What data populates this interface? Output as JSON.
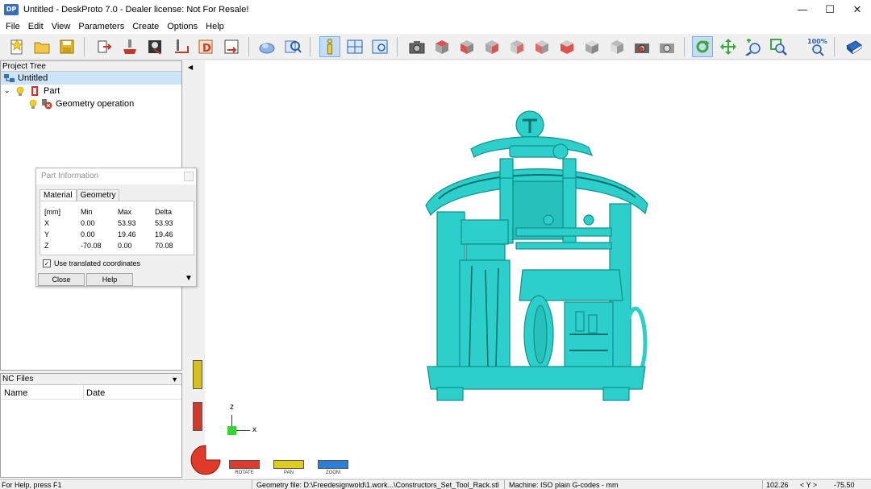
{
  "window": {
    "title": "Untitled - DeskProto 7.0 - Dealer license: Not For Resale!",
    "app_icon_text": "DP",
    "minimize": "—",
    "maximize": "☐",
    "close": "✕"
  },
  "menu": [
    "File",
    "Edit",
    "View",
    "Parameters",
    "Create",
    "Options",
    "Help"
  ],
  "toolbar": {
    "zoom_label": "100%"
  },
  "project_tree": {
    "title": "Project Tree",
    "root": "Untitled",
    "part": "Part",
    "operation": "Geometry operation"
  },
  "nc_files": {
    "title": "NC Files",
    "col_name": "Name",
    "col_date": "Date"
  },
  "part_info": {
    "title": "Part Information",
    "tabs": [
      "Material",
      "Geometry"
    ],
    "headers": [
      "[mm]",
      "Min",
      "Max",
      "Delta"
    ],
    "rows": [
      [
        "X",
        "0.00",
        "53.93",
        "53.93"
      ],
      [
        "Y",
        "0.00",
        "19.46",
        "19.46"
      ],
      [
        "Z",
        "-70.08",
        "0.00",
        "70.08"
      ]
    ],
    "checkbox_label": "Use translated coordinates",
    "checkbox_checked": true,
    "close_label": "Close",
    "help_label": "Help"
  },
  "viewport": {
    "axis_z": "z",
    "axis_x": "x",
    "nav_rotate": "ROTATE",
    "nav_pan": "PAN",
    "nav_zoom": "ZOOM",
    "model_color": "#2ccfca"
  },
  "status": {
    "help": "For Help, press F1",
    "geometry": "Geometry file: D:\\Freedesignwold\\1.work...\\Constructors_Set_Tool_Rack.stl",
    "machine": "Machine: ISO plain G-codes - mm",
    "coord1": "102.26",
    "axis_sep": "< Y >",
    "coord2": "-75.50"
  }
}
